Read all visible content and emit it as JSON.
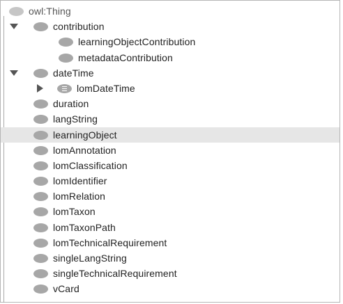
{
  "tree": {
    "root": {
      "label": "owl:Thing"
    },
    "contribution": {
      "label": "contribution",
      "children": [
        "learningObjectContribution",
        "metadataContribution"
      ]
    },
    "dateTime": {
      "label": "dateTime",
      "child": "lomDateTime"
    },
    "classes": [
      "duration",
      "langString",
      "learningObject",
      "lomAnnotation",
      "lomClassification",
      "lomIdentifier",
      "lomRelation",
      "lomTaxon",
      "lomTaxonPath",
      "lomTechnicalRequirement",
      "singleLangString",
      "singleTechnicalRequirement",
      "vCard"
    ],
    "selected": "learningObject"
  },
  "icons": {
    "expanded": "triangle-down-icon",
    "collapsed": "triangle-right-icon",
    "class": "class-ellipse-icon",
    "defined_class": "defined-class-icon"
  },
  "colors": {
    "selection_background": "#e6e6e6",
    "class_icon": "#a7a7a7",
    "root_icon": "#c6c6c6"
  }
}
